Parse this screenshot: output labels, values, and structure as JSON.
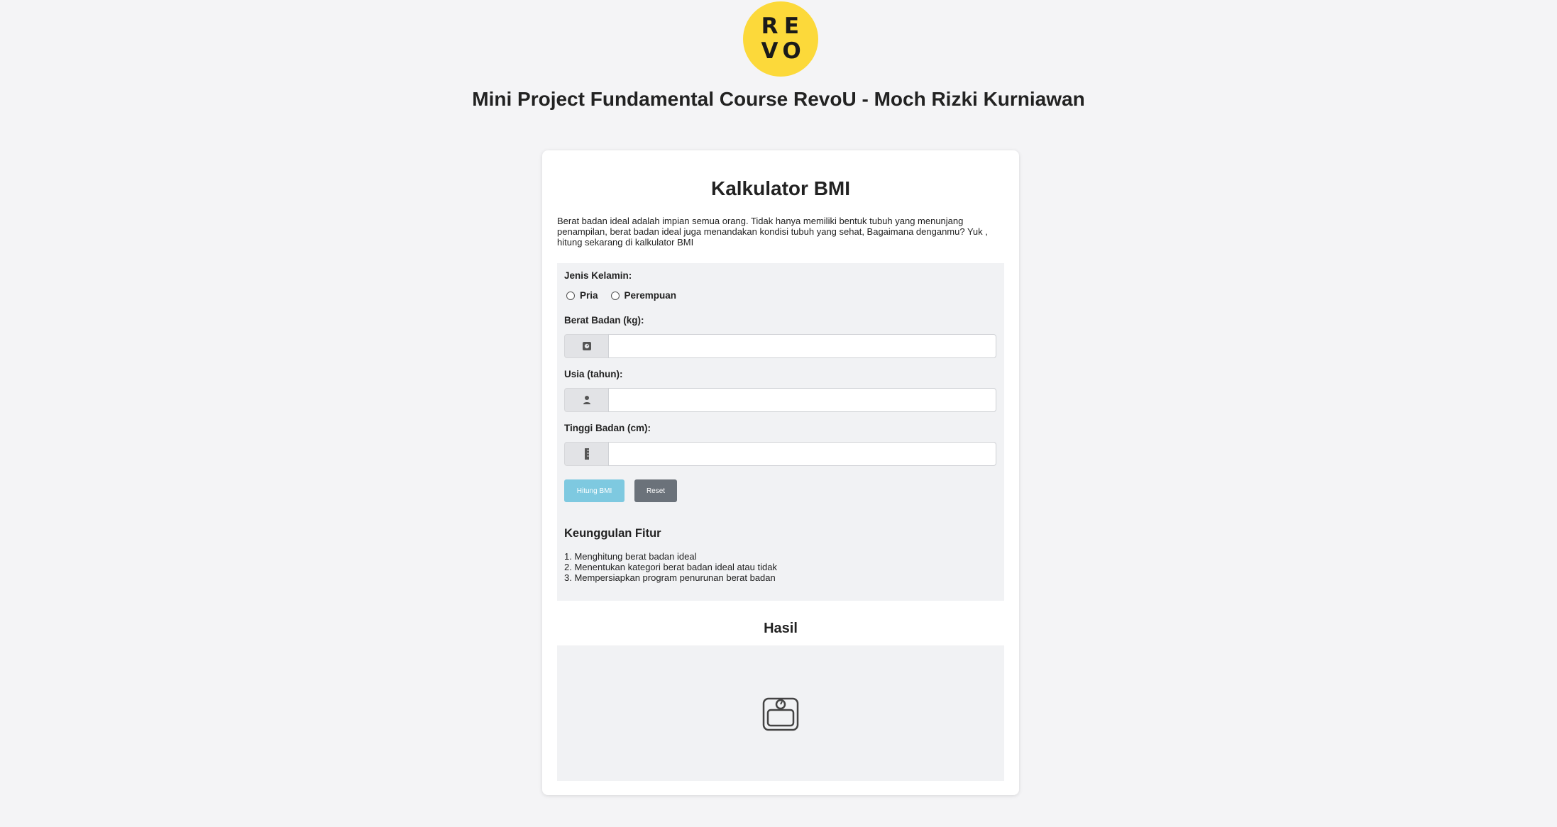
{
  "logo": {
    "letters": [
      "R",
      "E",
      "V",
      "O"
    ],
    "bg_color": "#fcd93a"
  },
  "page_title": "Mini Project Fundamental Course RevoU - Moch Rizki Kurniawan",
  "card": {
    "title": "Kalkulator BMI",
    "intro": "Berat badan ideal adalah impian semua orang. Tidak hanya memiliki bentuk tubuh yang menunjang penampilan, berat badan ideal juga menandakan kondisi tubuh yang sehat, Bagaimana denganmu? Yuk , hitung sekarang di kalkulator BMI"
  },
  "form": {
    "gender_label": "Jenis Kelamin:",
    "gender_options": [
      "Pria",
      "Perempuan"
    ],
    "weight_label": "Berat Badan (kg):",
    "weight_value": "",
    "weight_icon": "scale-icon",
    "age_label": "Usia (tahun):",
    "age_value": "",
    "age_icon": "user-icon",
    "height_label": "Tinggi Badan (cm):",
    "height_value": "",
    "height_icon": "ruler-icon",
    "hitung_label": "Hitung BMI",
    "reset_label": "Reset",
    "hitung_color": "#7ec9e0",
    "reset_color": "#6b727a"
  },
  "features": {
    "title": "Keunggulan Fitur",
    "items": [
      "1. Menghitung berat badan ideal",
      "2. Menentukan kategori berat badan ideal atau tidak",
      "3. Mempersiapkan program penurunan berat badan"
    ]
  },
  "result": {
    "title": "Hasil",
    "icon": "scale-icon"
  }
}
